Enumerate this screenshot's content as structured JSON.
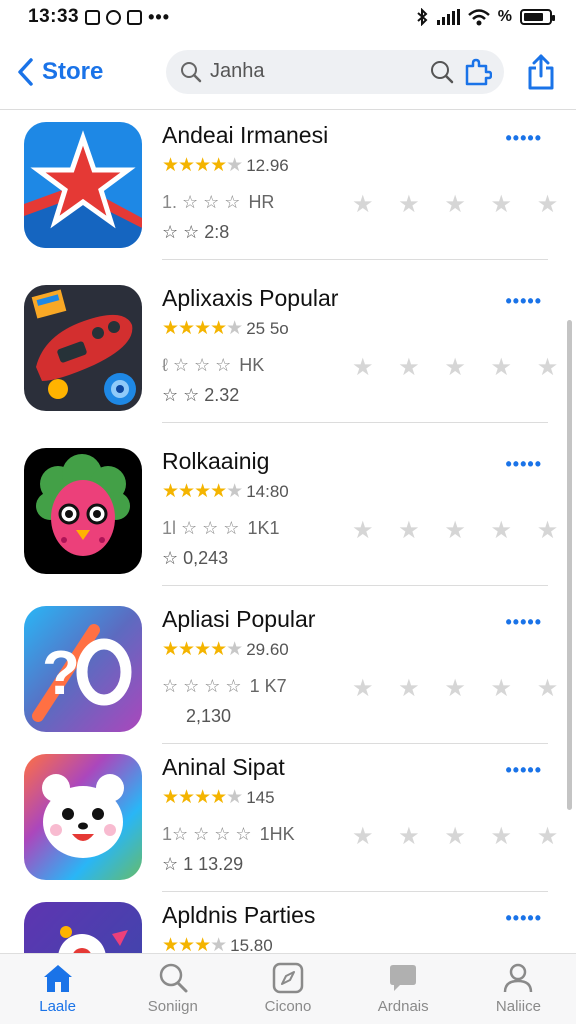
{
  "status_bar": {
    "time": "13:33",
    "dots": "•••",
    "battery_text": "%"
  },
  "nav": {
    "back_label": "Store",
    "search_value": "Janha"
  },
  "apps": [
    {
      "name": "Andeai Irmanesi",
      "rating_text": "12.96",
      "stars_full": 4,
      "meta_a": "1. ☆ ☆ ☆",
      "meta_b": "HR",
      "meta_c": "☆ ☆ 2:8",
      "more": "•••••",
      "icon": "star"
    },
    {
      "name": "Aplixaxis Popular",
      "rating_text": "25 5o",
      "stars_full": 4,
      "meta_a": "ℓ ☆ ☆ ☆",
      "meta_b": "HK",
      "meta_c": "☆ ☆ 2.32",
      "more": "•••••",
      "icon": "robot"
    },
    {
      "name": "Rolkaainig",
      "rating_text": "14:80",
      "stars_full": 4,
      "meta_a": "1l ☆ ☆ ☆",
      "meta_b": "1K1",
      "meta_c": "☆ 0,243",
      "more": "•••••",
      "icon": "monster"
    },
    {
      "name": "Apliasi Popular",
      "rating_text": "29.60",
      "stars_full": 4,
      "meta_a": "☆ ☆ ☆ ☆",
      "meta_b": "1 K7",
      "meta_c": "2,130",
      "more": "•••••",
      "icon": "letters"
    },
    {
      "name": "Aninal Sipat",
      "rating_text": "145",
      "stars_full": 4,
      "meta_a": "1☆ ☆ ☆ ☆",
      "meta_b": "1HK",
      "meta_c": "☆ 1 13.29",
      "more": "•••••",
      "icon": "bear"
    },
    {
      "name": "Apldnis Parties",
      "rating_text": "15.80",
      "stars_full": 3,
      "meta_a": "",
      "meta_b": "",
      "meta_c": "",
      "more": "•••••",
      "icon": "partial"
    }
  ],
  "ghost_stars": "★ ★ ★ ★ ★ ☆",
  "tabs": [
    {
      "label": "Laale",
      "icon": "home-icon",
      "active": true
    },
    {
      "label": "Soniign",
      "icon": "search-icon",
      "active": false
    },
    {
      "label": "Cicono",
      "icon": "compass-icon",
      "active": false
    },
    {
      "label": "Ardnais",
      "icon": "chat-icon",
      "active": false
    },
    {
      "label": "Naliice",
      "icon": "person-icon",
      "active": false
    }
  ],
  "colors": {
    "accent": "#1a73e8",
    "star_gold": "#f4b400"
  }
}
